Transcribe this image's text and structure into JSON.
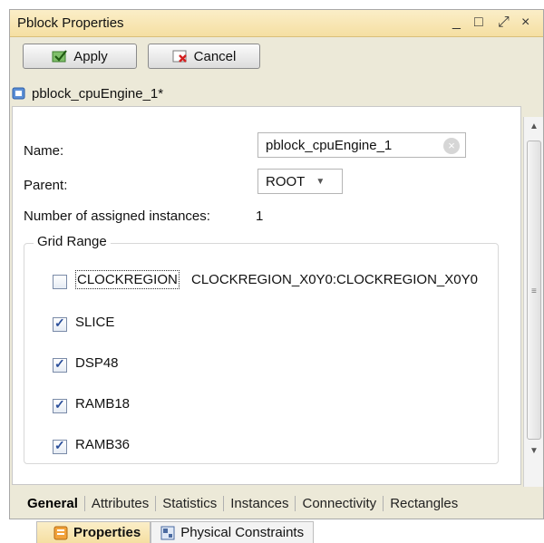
{
  "window": {
    "title": "Pblock Properties",
    "controls": [
      "_",
      "□",
      "⤢",
      "×"
    ]
  },
  "toolbar": {
    "apply_label": "Apply",
    "cancel_label": "Cancel"
  },
  "breadcrumb": {
    "label": "pblock_cpuEngine_1*"
  },
  "form": {
    "name_label": "Name:",
    "name_value": "pblock_cpuEngine_1",
    "parent_label": "Parent:",
    "parent_value": "ROOT",
    "instances_label": "Number of assigned instances:",
    "instances_value": "1"
  },
  "grid_range": {
    "title": "Grid Range",
    "items": [
      {
        "label": "CLOCKREGION",
        "checked": false,
        "value": "CLOCKREGION_X0Y0:CLOCKREGION_X0Y0"
      },
      {
        "label": "SLICE",
        "checked": true,
        "value": ""
      },
      {
        "label": "DSP48",
        "checked": true,
        "value": ""
      },
      {
        "label": "RAMB18",
        "checked": true,
        "value": ""
      },
      {
        "label": "RAMB36",
        "checked": true,
        "value": ""
      }
    ]
  },
  "tabs": [
    {
      "label": "General",
      "active": true
    },
    {
      "label": "Attributes",
      "active": false
    },
    {
      "label": "Statistics",
      "active": false
    },
    {
      "label": "Instances",
      "active": false
    },
    {
      "label": "Connectivity",
      "active": false
    },
    {
      "label": "Rectangles",
      "active": false
    }
  ],
  "bottom_tabs": [
    {
      "label": "Properties",
      "active": true
    },
    {
      "label": "Physical Constraints",
      "active": false
    }
  ],
  "colors": {
    "titlebar": "#f5dfa2",
    "panel_bg": "#ffffff",
    "chrome_bg": "#ece9d8"
  }
}
